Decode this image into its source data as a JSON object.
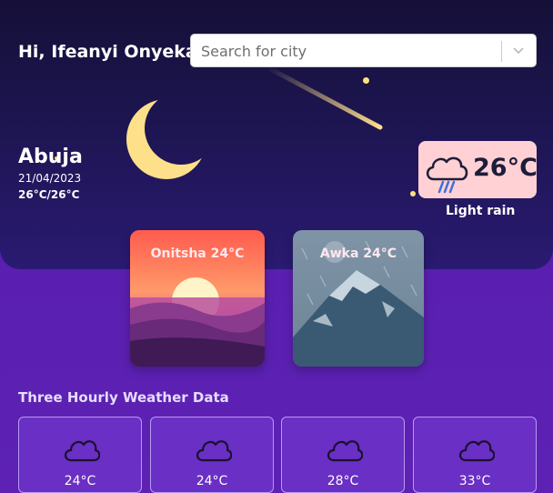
{
  "header": {
    "greeting": "Hi, Ifeanyi Onyeka",
    "search_placeholder": "Search for city"
  },
  "current": {
    "city": "Abuja",
    "date": "21/04/2023",
    "temp_range": "26°C/26°C",
    "temperature": "26°C",
    "condition": "Light rain",
    "icon": "rain-cloud-icon"
  },
  "city_cards": [
    {
      "label": "Onitsha 24°C",
      "image": "sunset-image"
    },
    {
      "label": "Awka 24°C",
      "image": "rainy-mountain-image"
    }
  ],
  "hourly": {
    "title": "Three Hourly Weather Data",
    "items": [
      {
        "temp": "24°C",
        "icon": "cloud-icon"
      },
      {
        "temp": "24°C",
        "icon": "cloud-icon"
      },
      {
        "temp": "28°C",
        "icon": "cloud-icon"
      },
      {
        "temp": "33°C",
        "icon": "cloud-icon"
      }
    ]
  },
  "colors": {
    "hero_background": "#1d1550",
    "page_background": "#5a1fb0",
    "weather_card": "#ffd1d4",
    "moon": "#ffe08a"
  }
}
